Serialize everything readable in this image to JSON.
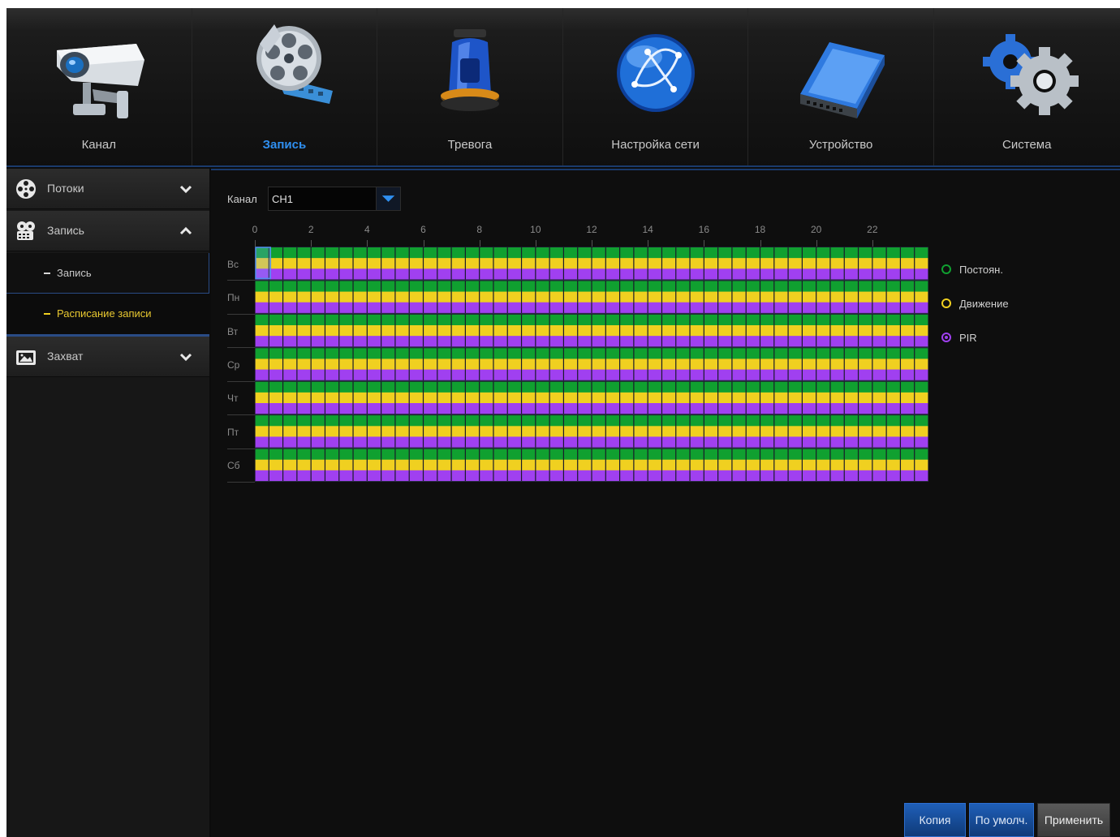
{
  "nav": {
    "tabs": [
      {
        "label": "Канал",
        "icon": "camera-icon"
      },
      {
        "label": "Запись",
        "icon": "film-reel-icon",
        "active": true
      },
      {
        "label": "Тревога",
        "icon": "alarm-siren-icon"
      },
      {
        "label": "Настройка сети",
        "icon": "network-globe-icon"
      },
      {
        "label": "Устройство",
        "icon": "hard-drive-icon"
      },
      {
        "label": "Система",
        "icon": "gears-icon"
      }
    ]
  },
  "sidebar": {
    "groups": [
      {
        "label": "Потоки",
        "icon": "film-reel-icon",
        "expanded": false
      },
      {
        "label": "Запись",
        "icon": "film-camera-icon",
        "expanded": true,
        "items": [
          {
            "label": "Запись"
          },
          {
            "label": "Расписание записи",
            "selected": true
          }
        ]
      },
      {
        "label": "Захват",
        "icon": "image-capture-icon",
        "expanded": false
      }
    ]
  },
  "main": {
    "channel_label": "Канал",
    "channel_value": "CH1",
    "hour_ticks": [
      "0",
      "2",
      "4",
      "6",
      "8",
      "10",
      "12",
      "14",
      "16",
      "18",
      "20",
      "22"
    ],
    "days": [
      "Вс",
      "Пн",
      "Вт",
      "Ср",
      "Чт",
      "Пт",
      "Сб"
    ],
    "hours_per_day": 24,
    "schedule_all_enabled": true,
    "selected_cell": {
      "day": "Вс",
      "hour": "0"
    },
    "legend": [
      {
        "label": "Постоян.",
        "color": "#10a030",
        "selected": false
      },
      {
        "label": "Движение",
        "color": "#f0d020",
        "selected": false
      },
      {
        "label": "PIR",
        "color": "#a040f0",
        "selected": true
      }
    ]
  },
  "buttons": {
    "copy": "Копия",
    "default": "По умолч.",
    "apply": "Применить"
  },
  "colors": {
    "accent": "#2f8ff0",
    "continuous": "#10a030",
    "motion": "#f0d020",
    "pir": "#a040f0",
    "selected_item": "#e8c830"
  }
}
